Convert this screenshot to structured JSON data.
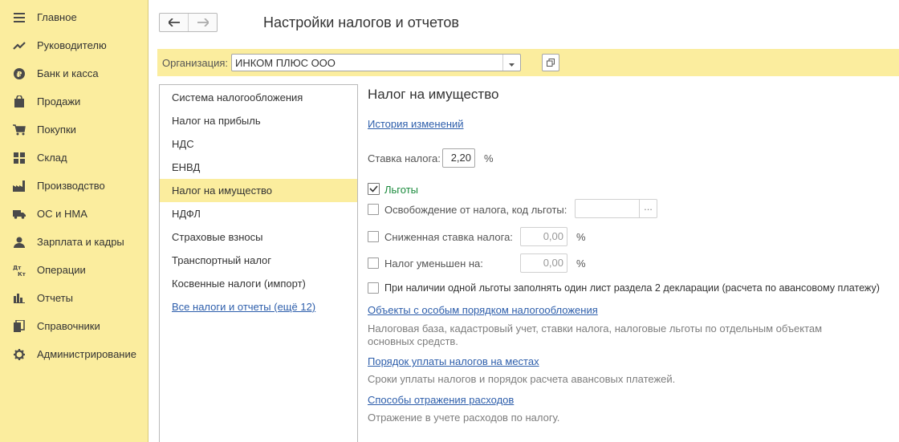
{
  "sidebar": {
    "items": [
      {
        "label": "Главное",
        "icon": "menu-icon"
      },
      {
        "label": "Руководителю",
        "icon": "trend-icon"
      },
      {
        "label": "Банк и касса",
        "icon": "ruble-coin-icon"
      },
      {
        "label": "Продажи",
        "icon": "shopping-bag-icon"
      },
      {
        "label": "Покупки",
        "icon": "cart-icon"
      },
      {
        "label": "Склад",
        "icon": "warehouse-icon"
      },
      {
        "label": "Производство",
        "icon": "factory-icon"
      },
      {
        "label": "ОС и НМА",
        "icon": "truck-icon"
      },
      {
        "label": "Зарплата и кадры",
        "icon": "person-icon"
      },
      {
        "label": "Операции",
        "icon": "debit-credit-icon"
      },
      {
        "label": "Отчеты",
        "icon": "bar-chart-icon"
      },
      {
        "label": "Справочники",
        "icon": "books-icon"
      },
      {
        "label": "Администрирование",
        "icon": "gear-icon"
      }
    ]
  },
  "header": {
    "title": "Настройки налогов и отчетов",
    "back_icon": "arrow-left-icon",
    "forward_icon": "arrow-right-icon"
  },
  "org": {
    "label": "Организация:",
    "value": "ИНКОМ ПЛЮС ООО"
  },
  "tax_list": {
    "items": [
      {
        "label": "Система налогообложения"
      },
      {
        "label": "Налог на прибыль"
      },
      {
        "label": "НДС"
      },
      {
        "label": "ЕНВД"
      },
      {
        "label": "Налог на имущество"
      },
      {
        "label": "НДФЛ"
      },
      {
        "label": "Страховые взносы"
      },
      {
        "label": "Транспортный налог"
      },
      {
        "label": "Косвенные налоги (импорт)"
      }
    ],
    "selected": "Налог на имущество",
    "all_link": "Все налоги и отчеты (ещё 12)"
  },
  "main": {
    "section_title": "Налог на имущество",
    "history_link": "История изменений",
    "rate_label": "Ставка налога:",
    "rate_value": "2,20",
    "rate_unit": "%",
    "benefits_label": "Льготы",
    "benefits_checked": true,
    "exemption_label": "Освобождение от налога, код льготы:",
    "exemption_value": "",
    "exemption_button": "...",
    "reduced_rate_label": "Сниженная ставка налога:",
    "reduced_rate_value": "0,00",
    "reduced_rate_unit": "%",
    "reduced_tax_label": "Налог уменьшен на:",
    "reduced_tax_value": "0,00",
    "reduced_tax_unit": "%",
    "one_sheet_label": "При наличии одной льготы заполнять один лист раздела 2 декларации (расчета по авансовому платежу)",
    "objects_link": "Объекты с особым порядком налогообложения",
    "objects_desc_line1": "Налоговая база, кадастровый учет, ставки налога, налоговые льготы по отдельным объектам",
    "objects_desc_line2": "основных средств.",
    "payment_link": "Порядок уплаты налогов на местах",
    "payment_desc": "Сроки уплаты налогов и порядок расчета авансовых платежей.",
    "expenses_link": "Способы отражения расходов",
    "expenses_desc": "Отражение в учете расходов по налогу."
  },
  "colors": {
    "sidebar_bg": "#fbed9e",
    "selection_bg": "#fbed9e",
    "link": "#2d5eab",
    "benefits_green": "#1a8a3c",
    "icon": "#4a4a4a"
  }
}
